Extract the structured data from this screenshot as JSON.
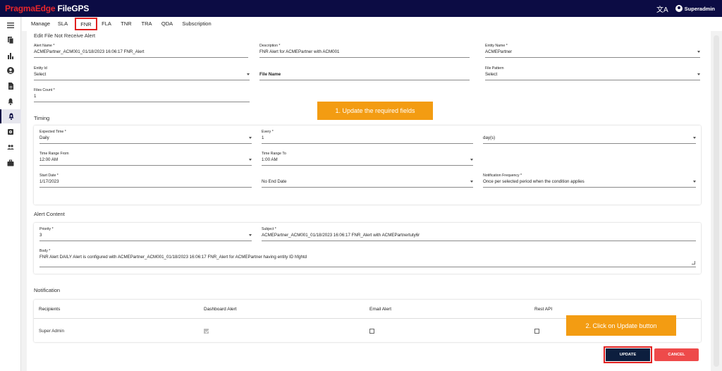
{
  "app": {
    "brand_part1": "PragmaEdge",
    "brand_part2": " FileGPS",
    "user_name": "Superadmin"
  },
  "tabs": [
    "Manage",
    "SLA",
    "FNR",
    "FLA",
    "TNR",
    "TRA",
    "QDA",
    "Subscription"
  ],
  "form": {
    "title": "Edit File Not Receive Alert",
    "alert_name": {
      "label": "Alert Name *",
      "value": "ACMEPartner_ACM001_01/18/2023 16:06:17 FNR_Alert"
    },
    "description": {
      "label": "Description *",
      "value": "FNR Alert for ACMEPartner with ACM001"
    },
    "entity_name": {
      "label": "Entity Name *",
      "value": "ACMEPartner"
    },
    "entity_id": {
      "label": "Entity Id",
      "value": "Select"
    },
    "file_name": {
      "label": "File Name"
    },
    "file_pattern": {
      "label": "File Pattern",
      "value": "Select"
    },
    "files_count": {
      "label": "Files Count *",
      "value": "1"
    }
  },
  "timing": {
    "title": "Timing",
    "expected_time": {
      "label": "Expected Time *",
      "value": "Daily"
    },
    "every": {
      "label": "Every *",
      "value": "1"
    },
    "every_unit": {
      "value": "day(s)"
    },
    "range_from": {
      "label": "Time Range From",
      "value": "12:00 AM"
    },
    "range_to": {
      "label": "Time Range To",
      "value": "1:00 AM"
    },
    "start_date": {
      "label": "Start Date *",
      "value": "1/17/2023"
    },
    "end_date": {
      "value": "No End Date"
    },
    "notif_freq": {
      "label": "Notification Frequency *",
      "value": "Once per selected period when the condition applies"
    }
  },
  "alert_content": {
    "title": "Alert Content",
    "priority": {
      "label": "Priority *",
      "value": "3"
    },
    "subject": {
      "label": "Subject *",
      "value": "ACMEPartner_ACM001_01/18/2023 16:06:17 FNR_Alert with ACMEPartnertuty6r"
    },
    "body": {
      "label": "Body *",
      "value": "FNR Alert DAILY Alert is configured with ACMEPartner_ACM001_01/18/2023 16:06:17 FNR_Alert for ACMEPartner having entity ID hfghtd"
    }
  },
  "notification": {
    "title": "Notification",
    "headers": [
      "Recipients",
      "Dashboard Alert",
      "Email Alert",
      "Rest API"
    ],
    "rows": [
      {
        "recipient": "Super Admin",
        "dashboard": true,
        "email": false,
        "rest": false
      }
    ]
  },
  "callouts": {
    "step1": "1. Update the required fields",
    "step2": "2. Click on Update button"
  },
  "buttons": {
    "update": "UPDATE",
    "cancel": "CANCEL"
  },
  "colors": {
    "topbar": "#0c0c44",
    "brand_red": "#e8262b",
    "callout": "#f39c12",
    "update_btn": "#0c1e3e",
    "cancel_btn": "#ee4a4a",
    "highlight": "#e02020"
  },
  "sidebar_icons": [
    "menu-icon",
    "files-icon",
    "bar-chart-icon",
    "account-icon",
    "document-icon",
    "bell-icon",
    "alert-settings-icon",
    "gear-icon",
    "people-icon",
    "briefcase-icon"
  ]
}
